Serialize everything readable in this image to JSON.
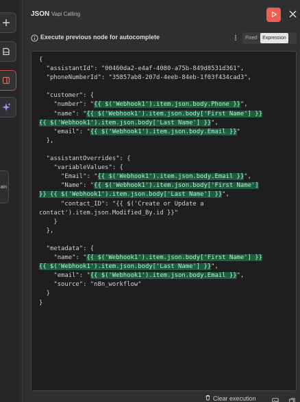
{
  "toolbar": {
    "left_tab_label": "ain",
    "tools": [
      {
        "icon": "plus-icon"
      },
      {
        "icon": "note-icon"
      },
      {
        "icon": "panel-icon"
      },
      {
        "icon": "sparkle-icon"
      }
    ]
  },
  "header": {
    "title": "JSON",
    "subtitle": "Vapi Calling",
    "run_icon": "play-icon",
    "close_icon": "close-icon"
  },
  "info": {
    "text": "Execute previous node for autocomplete",
    "mode_options": [
      "Fixed",
      "Expression"
    ],
    "mode_selected": "Expression"
  },
  "editor": {
    "lines": [
      [
        {
          "t": "{"
        }
      ],
      [
        {
          "t": "  \"assistantId\": \"00460da2-e4af-4080-a75b-849d8531d361\","
        }
      ],
      [
        {
          "t": "  \"phoneNumberId\": \"35857ab8-207d-4eeb-84eb-1f03f434cad3\","
        }
      ],
      [
        {
          "t": ""
        }
      ],
      [
        {
          "t": "  \"customer\": {"
        }
      ],
      [
        {
          "t": "    \"number\": \""
        },
        {
          "t": "{{ $('Webhook1').item.json.body.Phone }}",
          "h": true
        },
        {
          "t": "\","
        }
      ],
      [
        {
          "t": "    \"name\": \""
        },
        {
          "t": "{{ $('Webhook1').item.json.body['First Name'] }}",
          "h": true
        }
      ],
      [
        {
          "t": "{{ $('Webhook1').item.json.body['Last Name'] }}",
          "h": true
        },
        {
          "t": "\","
        }
      ],
      [
        {
          "t": "    \"email\": \""
        },
        {
          "t": "{{ $('Webhook1').item.json.body.Email }}",
          "h": true
        },
        {
          "t": "\""
        }
      ],
      [
        {
          "t": "  },"
        }
      ],
      [
        {
          "t": ""
        }
      ],
      [
        {
          "t": "  \"assistantOverrides\": {"
        }
      ],
      [
        {
          "t": "    \"variableValues\": {"
        }
      ],
      [
        {
          "t": "      \"Email\": \""
        },
        {
          "t": "{{ $('Webhook1').item.json.body.Email }}",
          "h": true
        },
        {
          "t": "\","
        }
      ],
      [
        {
          "t": "      \"Name\": \""
        },
        {
          "t": "{{ $('Webhook1').item.json.body['First Name']",
          "h": true
        }
      ],
      [
        {
          "t": "}} {{ $('Webhook1').item.json.body['Last Name'] }}",
          "h": true
        },
        {
          "t": "\","
        }
      ],
      [
        {
          "t": "      \"contact_ID\": \"{{ $('Create or Update a"
        }
      ],
      [
        {
          "t": "contact').item.json.Modified_By.id }}\""
        }
      ],
      [
        {
          "t": "    }"
        }
      ],
      [
        {
          "t": "  },"
        }
      ],
      [
        {
          "t": ""
        }
      ],
      [
        {
          "t": "  \"metadata\": {"
        }
      ],
      [
        {
          "t": "    \"name\": \""
        },
        {
          "t": "{{ $('Webhook1').item.json.body['First Name'] }}",
          "h": true
        }
      ],
      [
        {
          "t": "{{ $('Webhook1').item.json.body['Last Name'] }}",
          "h": true
        },
        {
          "t": "\","
        }
      ],
      [
        {
          "t": "    \"email\": \""
        },
        {
          "t": "{{ $('Webhook1').item.json.body.Email }}",
          "h": true
        },
        {
          "t": "\","
        }
      ],
      [
        {
          "t": "    \"source\": \"n8n_workflow\""
        }
      ],
      [
        {
          "t": "  }"
        }
      ],
      [
        {
          "t": "}"
        }
      ]
    ]
  },
  "footer": {
    "clear_label": "Clear execution",
    "clear_icon": "trash-icon"
  },
  "colors": {
    "run_button": "#ea5f52",
    "highlight_bg": "#1f5c40",
    "highlight_text": "#b9f0cf"
  }
}
